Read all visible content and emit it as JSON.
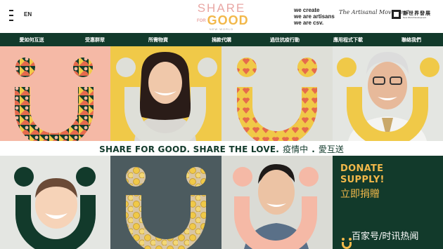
{
  "header": {
    "lang_label": "EN",
    "logo": {
      "line1": "SHARE",
      "line2_for": "FOR",
      "line2": "GOOD",
      "line3": "NEW WORLD"
    },
    "brand_lines": [
      "we create",
      "we are artisans",
      "we are csv."
    ],
    "signature": "The Artisanal Movement",
    "company_cn": "新世界發展",
    "company_en": "New World Development"
  },
  "nav": {
    "items": [
      "愛如何互送",
      "受惠群眾",
      "所需物資",
      "捐款代購",
      "過往抗疫行動",
      "應用程式下載",
      "聯絡我們"
    ]
  },
  "tagline": {
    "english": "SHARE FOR GOOD. SHARE THE LOVE.",
    "chinese_1": "疫情中",
    "dot": ".",
    "chinese_2": "愛互送"
  },
  "donate": {
    "english_line1": "DONATE",
    "english_line2": "SUPPLY!",
    "chinese": "立即捐贈"
  },
  "watermark": "百家号/时讯热闻",
  "colors": {
    "brand_green": "#123a2b",
    "salmon": "#f5b9a6",
    "mustard": "#f0c948",
    "light_grey": "#dedfd8",
    "slate": "#4c5b5f",
    "accent_gold": "#f2b84a",
    "heart_red": "#e56a4c",
    "peach_smile": "#f5b9a6"
  },
  "icons": [
    "hamburger-menu-icon",
    "smile-icon"
  ]
}
